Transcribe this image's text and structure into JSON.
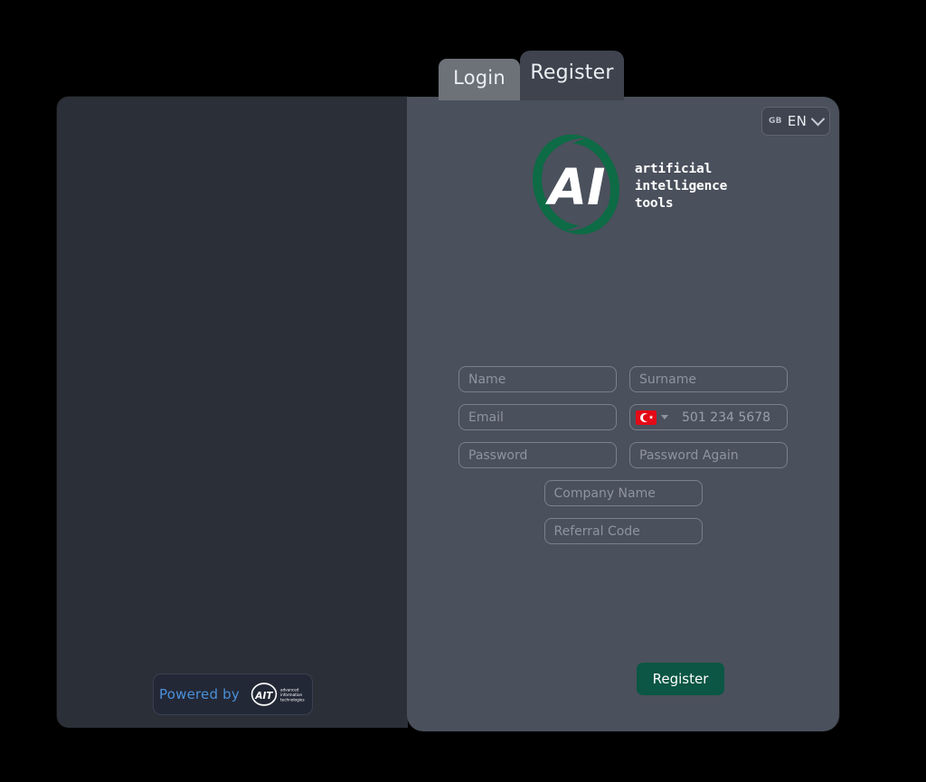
{
  "tabs": [
    {
      "id": "login",
      "label": "Login",
      "active": false
    },
    {
      "id": "register",
      "label": "Register",
      "active": true
    }
  ],
  "language": {
    "flag_code": "GB",
    "code": "EN",
    "chevron_icon": "chevron-down-icon"
  },
  "logo": {
    "mark_text": "AI",
    "line1": "artificial",
    "line2": "intelligence",
    "line3": "tools",
    "ring_color": "#0d6b45"
  },
  "form": {
    "name": {
      "placeholder": "Name",
      "value": ""
    },
    "surname": {
      "placeholder": "Surname",
      "value": ""
    },
    "email": {
      "placeholder": "Email",
      "value": ""
    },
    "phone": {
      "country": "TR",
      "placeholder": "501 234 5678",
      "value": ""
    },
    "password": {
      "placeholder": "Password",
      "value": ""
    },
    "password_again": {
      "placeholder": "Password Again",
      "value": ""
    },
    "company_name": {
      "placeholder": "Company Name",
      "value": ""
    },
    "referral_code": {
      "placeholder": "Referral Code",
      "value": ""
    },
    "submit_label": "Register",
    "submit_color": "#0b5644"
  },
  "footer": {
    "powered_by_text": "Powered by",
    "powered_by_color": "#4a90d9",
    "brand_mark": "AIT",
    "brand_line1": "advanced",
    "brand_line2": "information",
    "brand_line3": "technologies"
  }
}
